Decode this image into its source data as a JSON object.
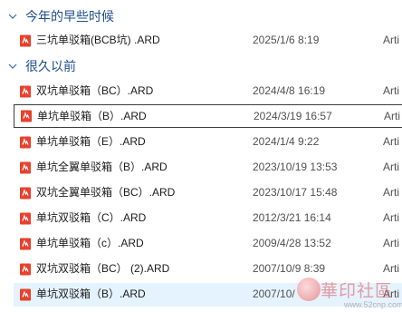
{
  "groups": [
    {
      "header": "今年的早些时候",
      "files": [
        {
          "name": "三坑单驳箱(BCB坑) .ARD",
          "date": "2025/1/6 8:19",
          "type": "Arti"
        }
      ]
    },
    {
      "header": "很久以前",
      "files": [
        {
          "name": "双坑单驳箱（BC）.ARD",
          "date": "2024/4/8 16:19",
          "type": "Arti"
        },
        {
          "name": "单坑单驳箱（B）.ARD",
          "date": "2024/3/19 16:57",
          "type": "Arti"
        },
        {
          "name": "单坑单驳箱（E）.ARD",
          "date": "2024/1/4 9:22",
          "type": "Arti"
        },
        {
          "name": "单坑全翼单驳箱（B）.ARD",
          "date": "2023/10/19 13:53",
          "type": "Arti"
        },
        {
          "name": "双坑全翼单驳箱（BC）.ARD",
          "date": "2023/10/17 15:48",
          "type": "Arti"
        },
        {
          "name": "单坑双驳箱（C）.ARD",
          "date": "2012/3/21 16:14",
          "type": "Arti"
        },
        {
          "name": "单坑单驳箱（c）.ARD",
          "date": "2009/4/28 13:52",
          "type": "Arti"
        },
        {
          "name": "双坑双驳箱（BC） (2).ARD",
          "date": "2007/10/9 8:39",
          "type": "Arti"
        },
        {
          "name": "单坑双驳箱（B）.ARD",
          "date": "2007/10/",
          "type": "Arti"
        }
      ]
    }
  ],
  "icon": "ard-file-icon",
  "colors": {
    "header_text": "#1f4e8c",
    "selected_bg": "#e5f3ff",
    "focus_border": "#3c3c3c",
    "file_icon": "#e8412c"
  },
  "watermark": {
    "text": "華印社區",
    "url": "www.52cnp.com"
  }
}
